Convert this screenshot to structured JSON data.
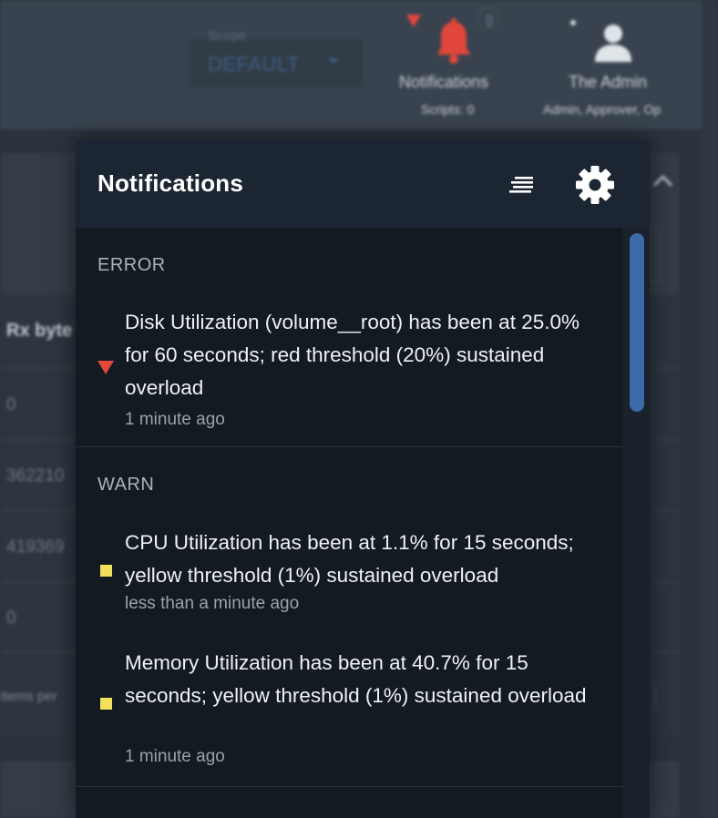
{
  "colors": {
    "error": "#e2483c",
    "warn": "#f2e05a",
    "accent": "#3d6aa8",
    "panel_bg": "#141a22"
  },
  "header": {
    "scope_label": "Scope",
    "scope_value": "DEFAULT",
    "notifications_label": "Notifications",
    "scripts_label": "Scripts: 0",
    "badge_value": "[]",
    "user_name": "The Admin",
    "user_roles": "Admin, Approver, Op"
  },
  "background_table": {
    "column_header": "Rx byte",
    "cells": [
      "0",
      "362210",
      "419369",
      "0"
    ],
    "footer_text": "Items per"
  },
  "panel": {
    "title": "Notifications",
    "sort_icon": "sort-lines-icon",
    "settings_icon": "gear-icon",
    "sections": [
      {
        "label": "ERROR",
        "items": [
          {
            "severity": "error",
            "icon": "red-triangle-icon",
            "message": "Disk Utilization (volume__root) has been at 25.0% for 60 seconds; red threshold (20%) sustained overload",
            "time": "1 minute ago"
          }
        ]
      },
      {
        "label": "WARN",
        "items": [
          {
            "severity": "warn",
            "icon": "yellow-square-icon",
            "message": "CPU Utilization has been at 1.1% for 15 sec­onds; yellow threshold (1%) sustained overload",
            "time": "less than a minute ago"
          },
          {
            "severity": "warn",
            "icon": "yellow-square-icon",
            "message": "Memory Utilization has been at 40.7% for 15 seconds; yellow threshold (1%) sustained overload",
            "time": "1 minute ago"
          }
        ]
      }
    ]
  }
}
